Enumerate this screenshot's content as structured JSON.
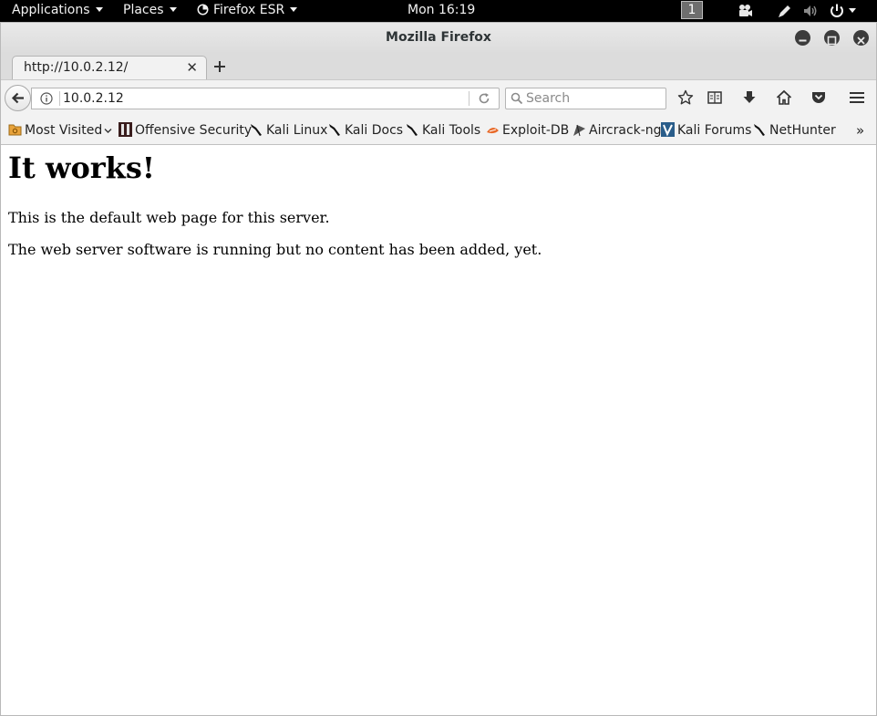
{
  "topbar": {
    "applications": "Applications",
    "places": "Places",
    "app_menu": "Firefox ESR",
    "clock": "Mon 16:19",
    "workspace": "1"
  },
  "window": {
    "title": "Mozilla Firefox"
  },
  "tab": {
    "label": "http://10.0.2.12/"
  },
  "navbar": {
    "url": "10.0.2.12",
    "search_placeholder": "Search"
  },
  "bookmarks": {
    "items": [
      {
        "label": "Most Visited",
        "icon": "folder-icon"
      },
      {
        "label": "Offensive Security",
        "icon": "offsec-icon"
      },
      {
        "label": "Kali Linux",
        "icon": "kali-dragon-icon"
      },
      {
        "label": "Kali Docs",
        "icon": "kali-dragon-icon"
      },
      {
        "label": "Kali Tools",
        "icon": "kali-dragon-icon"
      },
      {
        "label": "Exploit-DB",
        "icon": "exploitdb-icon"
      },
      {
        "label": "Aircrack-ng",
        "icon": "aircrack-icon"
      },
      {
        "label": "Kali Forums",
        "icon": "kali-forums-icon"
      },
      {
        "label": "NetHunter",
        "icon": "kali-dragon-icon"
      }
    ],
    "overflow": "»"
  },
  "page": {
    "heading": "It works!",
    "para1": "This is the default web page for this server.",
    "para2": "The web server software is running but no content has been added, yet."
  },
  "colors": {
    "topbar_bg": "#000000",
    "toolbar_bg": "#f2f2f2",
    "titlebar_bg": "#dcdcdc"
  }
}
